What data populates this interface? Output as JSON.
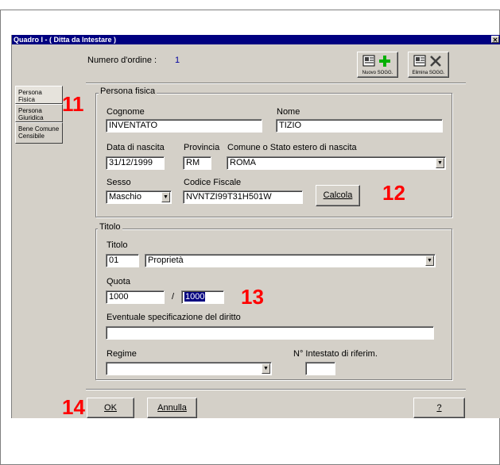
{
  "window": {
    "title": "Quadro I - ( Ditta da Intestare )",
    "close_glyph": "✕"
  },
  "header": {
    "numero_label": "Numero d'ordine :",
    "numero_value": "1"
  },
  "toolbar": {
    "new_label": "Nuovo SOGG.",
    "delete_label": "Elimina SOGG."
  },
  "tabs": [
    {
      "label": "Persona Fisica"
    },
    {
      "label": "Persona Giuridica"
    },
    {
      "label": "Bene Comune Censibile"
    }
  ],
  "persona": {
    "group_title": "Persona fisica",
    "cognome_label": "Cognome",
    "cognome_value": "INVENTATO",
    "nome_label": "Nome",
    "nome_value": "TIZIO",
    "data_label": "Data di nascita",
    "data_value": "31/12/1999",
    "provincia_label": "Provincia",
    "provincia_value": "RM",
    "comune_label": "Comune o Stato estero di nascita",
    "comune_value": "ROMA",
    "sesso_label": "Sesso",
    "sesso_value": "Maschio",
    "cf_label": "Codice Fiscale",
    "cf_value": "NVNTZI99T31H501W",
    "calcola_label": "Calcola"
  },
  "titolo": {
    "group_title": "Titolo",
    "titolo_label": "Titolo",
    "titolo_code": "01",
    "titolo_value": "Proprietà",
    "quota_label": "Quota",
    "quota_num": "1000",
    "quota_sep": "/",
    "quota_den": "1000",
    "spec_label": "Eventuale specificazione del diritto",
    "spec_value": "",
    "regime_label": "Regime",
    "regime_value": "",
    "intestato_label": "N° Intestato di riferim.",
    "intestato_value": ""
  },
  "buttons": {
    "ok": "OK",
    "annulla": "Annulla",
    "help": "?"
  },
  "callouts": {
    "n11": "11",
    "n12": "12",
    "n13": "13",
    "n14": "14"
  },
  "colors": {
    "titlebar": "#000080",
    "callout": "#ff0000",
    "selection": "#000080",
    "window_bg": "#d4d0c8"
  }
}
